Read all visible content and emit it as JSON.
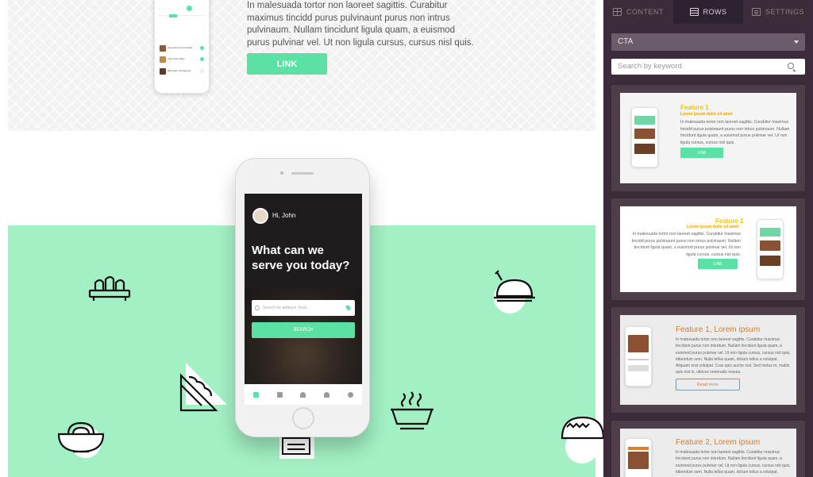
{
  "canvas": {
    "top_text": "In malesuada tortor non laoreet sagittis. Curabitur maximus tincidd purus pulvinaunt purus non intrus pulvinaum. Nullam tincidunt ligula quam, a euismod purus pulvinar vel. Ut non ligula cursus, cursus nisl quis.",
    "link_label": "LINK",
    "mini_phone": {
      "items": [
        "Greenland Fresh Salad",
        "The Fresh Table",
        "Barrington Restaurant"
      ]
    },
    "phone": {
      "greeting": "Hi, John",
      "headline": "What can we serve you today?",
      "search_placeholder": "Search for address, food...",
      "search_button": "SEARCH"
    }
  },
  "panel": {
    "tabs": [
      {
        "label": "CONTENT",
        "icon": "grid-icon"
      },
      {
        "label": "ROWS",
        "icon": "rows-icon"
      },
      {
        "label": "SETTINGS",
        "icon": "settings-icon"
      }
    ],
    "active_tab": "ROWS",
    "category_value": "CTA",
    "search_placeholder": "Search by keyword",
    "cards": [
      {
        "title": "Feature 1",
        "subtitle": "Lorem ipsum dolor sit amet",
        "text": "In malesuada tortor non laoreet sagittis. Curabitur maximus tincidd purus pulvinaunt purus non intrus pulvinaum. Nullam tincidunt ligula quam, a euismod purus pulvinar vel. Ut non ligula cursus, cursus nisl quis.",
        "button": "LINK"
      },
      {
        "title": "Feature 2",
        "subtitle": "Lorem ipsum dolor sit amet",
        "text": "In malesuada tortor non laoreet sagittis. Curabitur maximus tincidd purus pulvinaunt purus non intrus pulvinaum. Nullam tincidunt ligula quam, a euismod purus pulvinar vel. Ut non ligula cursus, cursus nisl quis.",
        "button": "LINK"
      },
      {
        "title": "Feature 1, Lorem ipsum",
        "text": "In malesuada tortor non laoreet sagittis. Curabitur maximus tincidunt purus non interdum. Nullam tincidunt ligula quam, a euismod purus pulvinar vel. Ut non ligula cursus, cursus nisl quis, bibendum sem. Nulla tellus quam, dictum tellus a volutpat. Aliquam erat volutpat. Cras quis auctor nisl. Sed metus m, mattis quis nisi in, ultrices venenatis massa.",
        "button": "Read more"
      },
      {
        "title": "Feature 2, Lorem ipsum",
        "text": "In malesuada tortor non laoreet sagittis. Curabitur maximus tincidunt purus non interdum. Nullam tincidunt ligula quam, a euismod purus pulvinar vel. Ut non ligula cursus, cursus nisl quis, bibendum sem. Nulla tellus quam, dictum tellus a volutpat."
      }
    ]
  },
  "colors": {
    "accent": "#5ce1a4",
    "panel_bg": "#3c2b38",
    "band_green": "#a3f0c4",
    "orange": "#e07b2a"
  },
  "icons": [
    "sushi-icon",
    "roast-chicken-icon",
    "sandwich-icon",
    "noodle-bowl-icon",
    "soup-bowl-icon",
    "taco-icon",
    "burger-box-icon"
  ]
}
